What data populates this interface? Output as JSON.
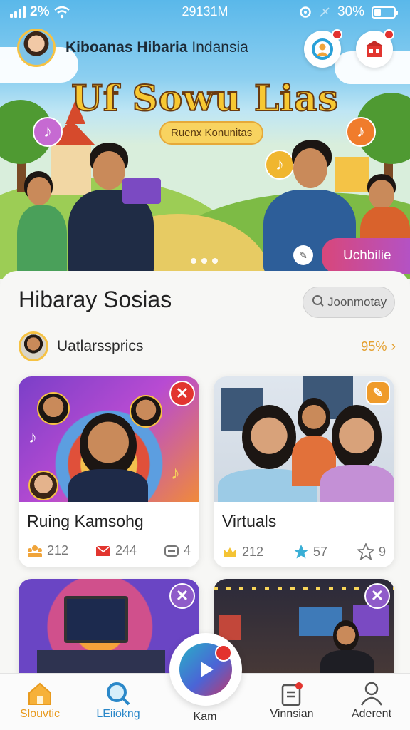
{
  "status_bar": {
    "battery_text": "2%",
    "time": "29131M",
    "battery_pct": "30%",
    "battery_level": 0.35
  },
  "header": {
    "user_name_bold": "Kiboanas Hibaria",
    "user_name_light": "Indansia",
    "icons": [
      "profile-search-icon",
      "store-icon"
    ]
  },
  "hero": {
    "title": "Uf Sowu Lias",
    "subtitle_pill": "Ruenx Konunitas",
    "tag": "Uchbilie",
    "carousel_dots": 3,
    "colors": {
      "title": "#f7c832",
      "tag_start": "#d8477a",
      "tag_end": "#b452c4"
    }
  },
  "section": {
    "title": "Hibaray Sosias",
    "search_text": "Joonmotay",
    "user": {
      "name": "Uatlarssprics",
      "percent": "95%"
    }
  },
  "cards": [
    {
      "title": "Ruing Kamsohg",
      "stats": [
        "212",
        "244",
        "4"
      ],
      "badge": "close-icon",
      "badge_color": "#e2352f"
    },
    {
      "title": "Virtuals",
      "stats": [
        "212",
        "57",
        "9"
      ],
      "badge": "edit-icon",
      "badge_color": "#ef9b2b"
    },
    {
      "title": "",
      "stats": [],
      "badge": "close-icon",
      "badge_color": "#8f5cc9"
    },
    {
      "title": "",
      "stats": [],
      "badge": "close-icon",
      "badge_color": "#8f5cc9"
    }
  ],
  "nav": {
    "items": [
      {
        "label": "Slouvtic",
        "icon": "home-icon",
        "active": true
      },
      {
        "label": "LEiiokng",
        "icon": "search-icon",
        "active": false
      },
      {
        "label": "Kam",
        "icon": "play-icon",
        "active": false
      },
      {
        "label": "Vinnsian",
        "icon": "clipboard-icon",
        "active": false
      },
      {
        "label": "Aderent",
        "icon": "person-icon",
        "active": false
      }
    ],
    "active_color": "#e89a1e",
    "accent_color": "#2b88c9"
  }
}
